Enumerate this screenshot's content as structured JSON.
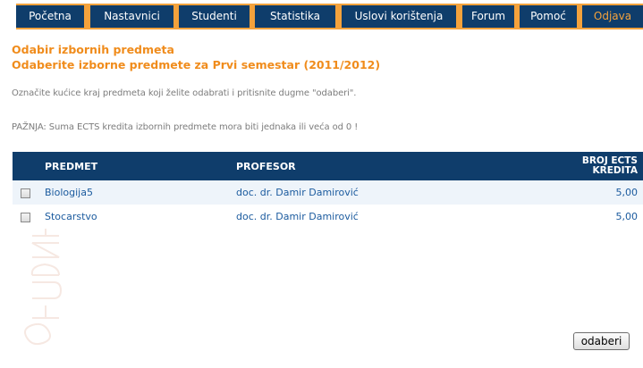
{
  "nav": {
    "items": [
      {
        "label": "Početna"
      },
      {
        "label": "Nastavnici"
      },
      {
        "label": "Studenti"
      },
      {
        "label": "Statistika"
      },
      {
        "label": "Uslovi korištenja"
      },
      {
        "label": "Forum"
      },
      {
        "label": "Pomoć"
      },
      {
        "label": "Odjava"
      }
    ],
    "accent_color": "#f4a23c",
    "background_color": "#0f3d6b"
  },
  "page": {
    "title": "Odabir izbornih predmeta",
    "subtitle": "Odaberite izborne predmete za Prvi semestar (2011/2012)",
    "instruction": "Označite kućice kraj predmeta koji želite odabrati i pritisnite dugme \"odaberi\".",
    "warning": "PAŽNJA: Suma ECTS kredita izbornih predmete mora biti jednaka ili veća od 0 !",
    "title_color": "#f08c1c"
  },
  "table": {
    "headers": {
      "course": "PREDMET",
      "professor": "PROFESOR",
      "ects_line1": "BROJ ECTS",
      "ects_line2": "KREDITA"
    },
    "rows": [
      {
        "course": "Biologija5",
        "professor": "doc. dr. Damir Damirović",
        "ects": "5,00",
        "checked": false
      },
      {
        "course": "Stocarstvo",
        "professor": "doc. dr. Damir Damirović",
        "ects": "5,00",
        "checked": false
      }
    ]
  },
  "form": {
    "submit_label": "odaberi"
  },
  "watermark": {
    "icon": "students-watermark-icon"
  }
}
